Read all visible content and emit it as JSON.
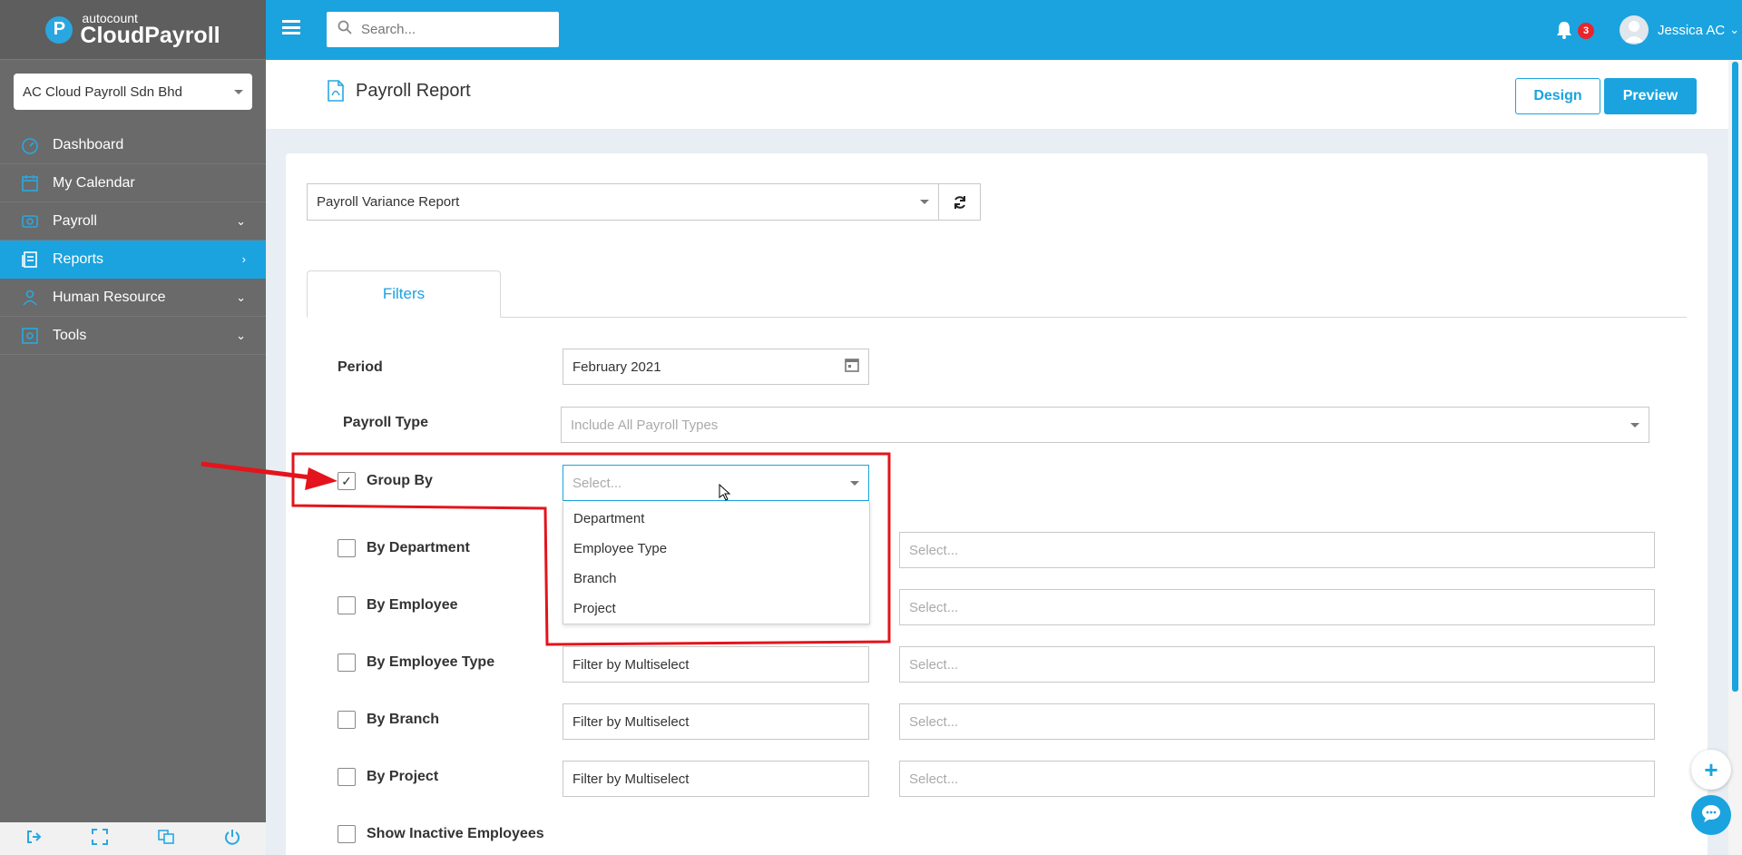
{
  "sidebar": {
    "brand_small": "autocount",
    "brand_big": "CloudPayroll",
    "company": "AC Cloud Payroll Sdn Bhd",
    "items": [
      {
        "label": "Dashboard"
      },
      {
        "label": "My Calendar"
      },
      {
        "label": "Payroll"
      },
      {
        "label": "Reports"
      },
      {
        "label": "Human Resource"
      },
      {
        "label": "Tools"
      }
    ]
  },
  "topbar": {
    "search_placeholder": "Search...",
    "notification_count": "3",
    "user_name": "Jessica AC"
  },
  "page": {
    "title": "Payroll Report",
    "design_label": "Design",
    "preview_label": "Preview"
  },
  "report": {
    "selected": "Payroll Variance Report"
  },
  "tabs": {
    "filters": "Filters"
  },
  "filters": {
    "period_label": "Period",
    "period_value": "February 2021",
    "payroll_type_label": "Payroll Type",
    "payroll_type_placeholder": "Include All Payroll Types",
    "group_by_label": "Group By",
    "group_by_placeholder": "Select...",
    "group_by_options": [
      "Department",
      "Employee Type",
      "Branch",
      "Project"
    ],
    "rows": [
      {
        "label": "By Department",
        "filter": "",
        "select": "Select..."
      },
      {
        "label": "By Employee",
        "filter": "",
        "select": "Select..."
      },
      {
        "label": "By Employee Type",
        "filter": "Filter by Multiselect",
        "select": "Select..."
      },
      {
        "label": "By Branch",
        "filter": "Filter by Multiselect",
        "select": "Select..."
      },
      {
        "label": "By Project",
        "filter": "Filter by Multiselect",
        "select": "Select..."
      }
    ],
    "show_inactive_label": "Show Inactive Employees"
  },
  "colors": {
    "accent": "#1aa3df",
    "sidebar": "#6a6a6a",
    "annotation": "#e3141b",
    "badge": "#e8262b"
  }
}
